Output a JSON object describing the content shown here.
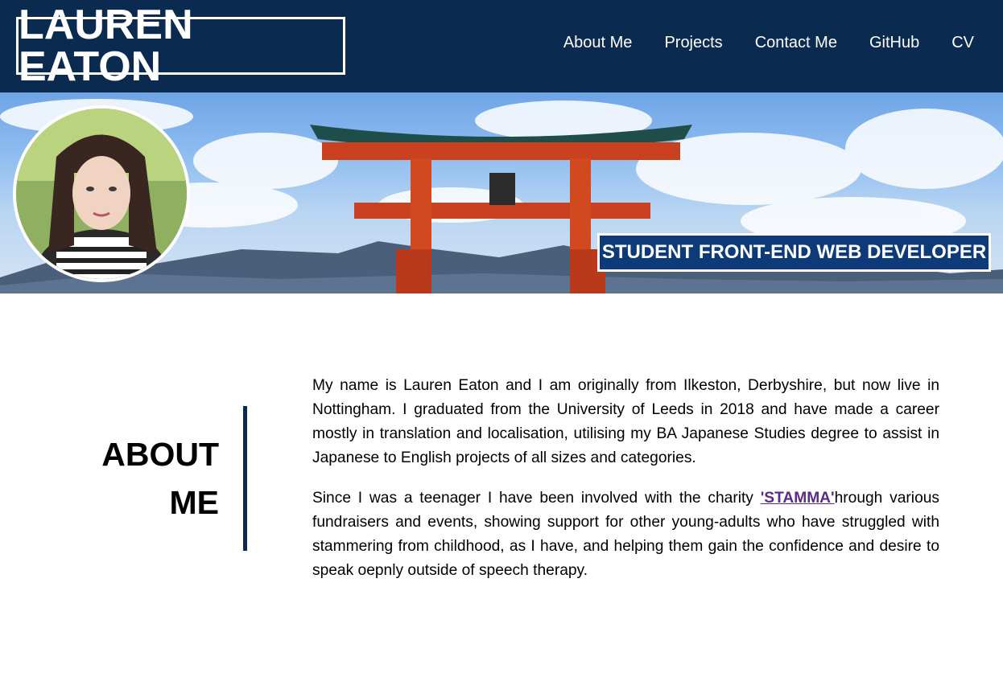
{
  "header": {
    "logo_text": "LAUREN EATON",
    "nav": [
      {
        "label": "About Me"
      },
      {
        "label": "Projects"
      },
      {
        "label": "Contact Me"
      },
      {
        "label": "GitHub"
      },
      {
        "label": "CV"
      }
    ],
    "background_color": "#0b2a50"
  },
  "hero": {
    "tagline": "STUDENT FRONT-END WEB DEVELOPER",
    "tagline_color": "#0d3a78"
  },
  "about": {
    "heading_line1": "ABOUT",
    "heading_line2": "ME",
    "paragraph1": "My name is Lauren Eaton and I am originally from Ilkeston, Derbyshire, but now live in Nottingham. I graduated from the University of Leeds in 2018 and have made a career mostly in translation and localisation, utilising my BA Japanese Studies degree to assist in Japanese to English projects of all sizes and categories.",
    "paragraph2_before": "Since I was a teenager I have been involved with the charity ",
    "charity_link": "'STAMMA'",
    "paragraph2_after": "hrough various fundraisers and events, showing support for other young-adults who have struggled with stammering from childhood, as I have, and helping them gain the confidence and desire to speak oepnly outside of speech therapy.",
    "link_color": "#5b2a8a"
  }
}
